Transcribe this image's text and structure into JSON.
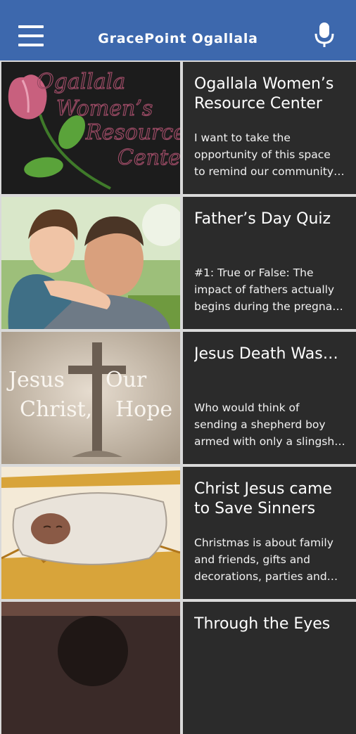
{
  "app_bar": {
    "title": "GracePoint Ogallala",
    "menu_icon": "hamburger-menu-icon",
    "mic_icon": "microphone-icon",
    "background": "#3d68ad"
  },
  "items": [
    {
      "title_lines": [
        "Ogallala Women’s",
        "Resource Center"
      ],
      "excerpt_lines": [
        "I want to take the",
        "opportunity of this space",
        "to remind our community…"
      ],
      "thumb_lines": [
        "Ogallala",
        "Women’s",
        "Resource",
        "Center"
      ]
    },
    {
      "title_lines": [
        "Father’s Day Quiz",
        ""
      ],
      "excerpt_lines": [
        "#1: True or False: The",
        "impact of fathers actually",
        "begins during the pregna…"
      ]
    },
    {
      "title_lines": [
        "Jesus Death Was…",
        ""
      ],
      "excerpt_lines": [
        "Who would think of",
        "sending a shepherd boy",
        "armed with only a slingsh…"
      ],
      "thumb_lines": [
        "Jesus",
        "Christ,",
        "Our",
        "Hope"
      ]
    },
    {
      "title_lines": [
        "Christ Jesus came",
        "to Save Sinners"
      ],
      "excerpt_lines": [
        "Christmas is about family",
        "and friends, gifts and",
        "decorations, parties and…"
      ]
    },
    {
      "title_lines": [
        "Through the Eyes",
        ""
      ],
      "excerpt_lines": [
        "",
        "",
        ""
      ]
    }
  ]
}
